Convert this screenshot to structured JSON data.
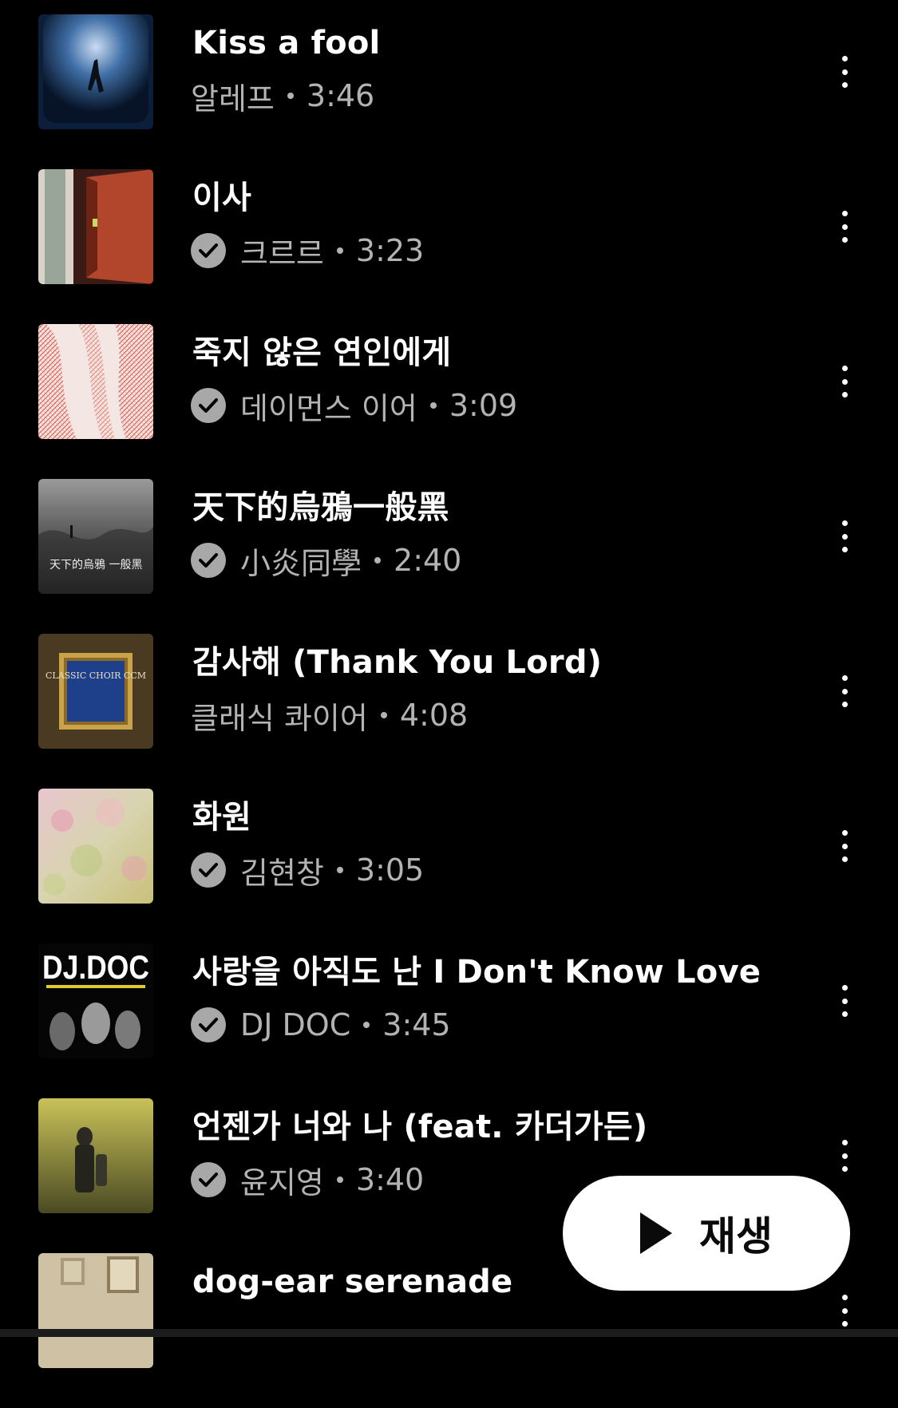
{
  "tracks": [
    {
      "title": "Kiss a fool",
      "artist": "알레프",
      "duration": "3:46",
      "verified": false
    },
    {
      "title": "이사",
      "artist": "크르르",
      "duration": "3:23",
      "verified": true
    },
    {
      "title": "죽지 않은 연인에게",
      "artist": "데이먼스 이어",
      "duration": "3:09",
      "verified": true
    },
    {
      "title": "天下的烏鴉一般黑",
      "artist": "小炎同學",
      "duration": "2:40",
      "verified": true
    },
    {
      "title": "감사해 (Thank You Lord)",
      "artist": "클래식 콰이어",
      "duration": "4:08",
      "verified": false
    },
    {
      "title": "화원",
      "artist": "김현창",
      "duration": "3:05",
      "verified": true
    },
    {
      "title": "사랑을 아직도 난 I Don't Know Love",
      "artist": "DJ DOC",
      "duration": "3:45",
      "verified": true
    },
    {
      "title": "언젠가 너와 나 (feat. 카더가든)",
      "artist": "윤지영",
      "duration": "3:40",
      "verified": true
    },
    {
      "title": "dog-ear serenade",
      "artist": "",
      "duration": "",
      "verified": true
    }
  ],
  "thumbnail_text": {
    "album4": "天下的烏鴉 一般黑",
    "album5": "CLASSIC CHOIR CCM",
    "album7": "DJ.DOC"
  },
  "play_button": {
    "label": "재생",
    "icon": "play-icon"
  },
  "icons": {
    "verified": "check-circle-icon",
    "more": "more-vertical-icon"
  },
  "colors": {
    "background": "#000000",
    "title": "#ffffff",
    "meta": "#b3b3b3",
    "button_bg": "#ffffff"
  }
}
